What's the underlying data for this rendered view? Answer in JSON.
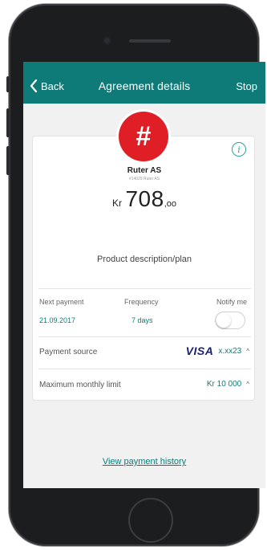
{
  "nav": {
    "back_label": "Back",
    "title": "Agreement details",
    "stop_label": "Stop"
  },
  "merchant": {
    "logo_symbol": "#",
    "name": "Ruter AS",
    "subtitle": "#14029 Ruter AS"
  },
  "amount": {
    "currency": "Kr",
    "main": "708",
    "decimal": ",oo"
  },
  "product_description": "Product description/plan",
  "schedule": {
    "next_payment_label": "Next payment",
    "next_payment_value": "21.09.2017",
    "frequency_label": "Frequency",
    "frequency_value": "7 days",
    "notify_label": "Notify me",
    "notify_enabled": false
  },
  "payment_source": {
    "label": "Payment source",
    "brand": "VISA",
    "card": "x.xx23"
  },
  "monthly_limit": {
    "label": "Maximum monthly limit",
    "value": "Kr 10 000"
  },
  "history_link": "View payment history",
  "colors": {
    "nav": "#0f7b78",
    "accent": "#0f7b78",
    "logo": "#e01e25",
    "visa": "#1a1f71"
  }
}
